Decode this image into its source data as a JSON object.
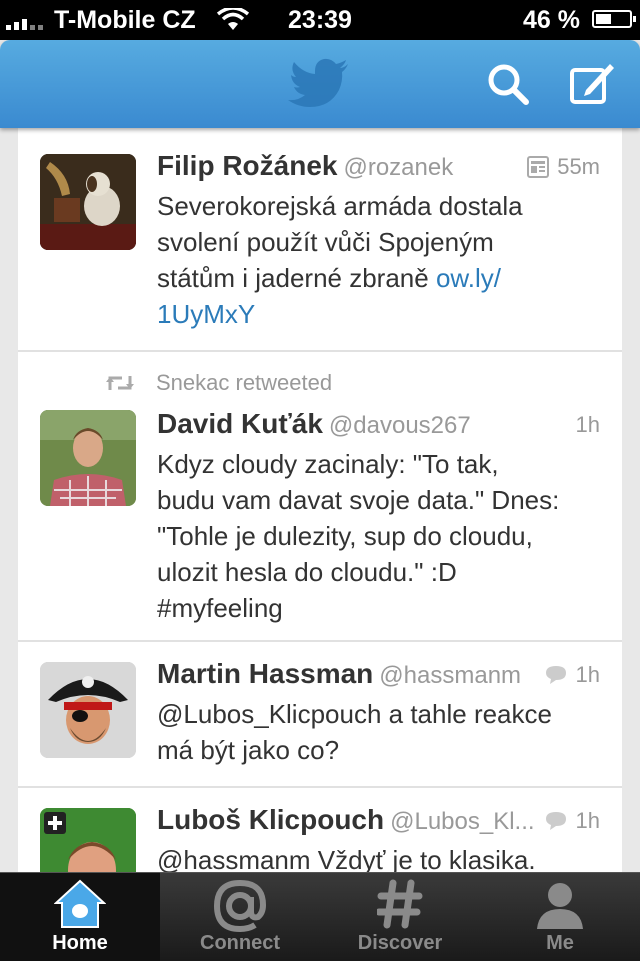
{
  "status": {
    "carrier": "T-Mobile CZ",
    "time": "23:39",
    "battery": "46 %",
    "battery_level": 0.46
  },
  "navbar": {
    "icons": [
      "twitter-bird-icon",
      "search-icon",
      "compose-icon"
    ]
  },
  "tweets": [
    {
      "name": "Filip Rožánek",
      "handle": "@rozanek",
      "time": "55m",
      "time_icon": "summary-card-icon",
      "lines": [
        "Severokorejská armáda dostala",
        "svolení použít vůči Spojeným"
      ],
      "line3": "státům i jaderné zbraně ",
      "link1": "ow.ly/",
      "link2": "1UyMxY"
    },
    {
      "retweeted_by": "Snekac retweeted",
      "name": "David Kuťák",
      "handle": "@davous267",
      "time": "1h",
      "lines": [
        "Kdyz cloudy zacinaly: \"To tak,",
        "budu vam davat svoje data.\" Dnes:",
        "\"Tohle je dulezity, sup do cloudu,",
        "ulozit hesla do cloudu.\" :D",
        "#myfeeling"
      ]
    },
    {
      "name": "Martin Hassman",
      "handle": "@hassmanm",
      "time": "1h",
      "time_icon": "reply-bubble-icon",
      "lines": [
        "@Lubos_Klicpouch a tahle reakce",
        "má být jako co?"
      ]
    },
    {
      "name": "Luboš Klicpouch",
      "handle": "@Lubos_Kl...",
      "time": "1h",
      "time_icon": "reply-bubble-icon",
      "lines": [
        "@hassmanm Vždyť je to klasika."
      ]
    }
  ],
  "tabs": [
    {
      "label": "Home",
      "icon": "home-icon",
      "active": true
    },
    {
      "label": "Connect",
      "icon": "at-icon"
    },
    {
      "label": "Discover",
      "icon": "hash-icon"
    },
    {
      "label": "Me",
      "icon": "person-icon"
    }
  ]
}
